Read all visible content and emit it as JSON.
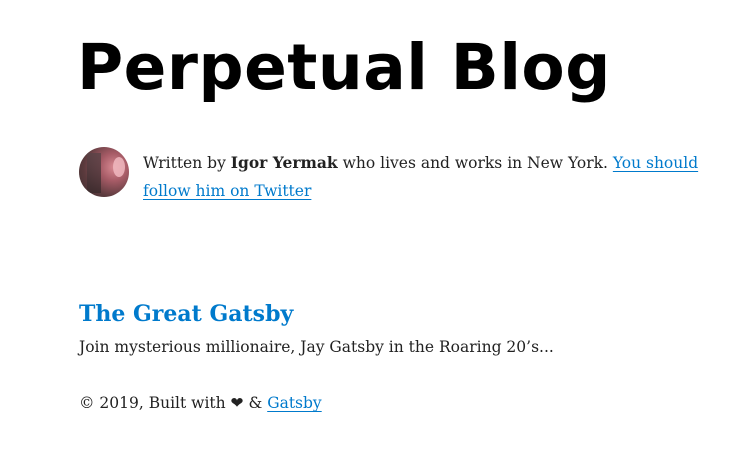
{
  "header": {
    "site_title": "Perpetual Blog"
  },
  "bio": {
    "prefix": "Written by ",
    "author": "Igor Yermak",
    "middle": " who lives and works in New York. ",
    "link_text": "You should follow him on Twitter"
  },
  "posts": [
    {
      "title": "The Great Gatsby",
      "excerpt": "Join mysterious millionaire, Jay Gatsby in the Roaring 20’s..."
    }
  ],
  "footer": {
    "prefix": "© 2019, Built with ",
    "heart": "❤",
    "amp": " & ",
    "link_text": "Gatsby"
  },
  "colors": {
    "link": "#007acc",
    "text": "#222222",
    "title": "#000000"
  }
}
